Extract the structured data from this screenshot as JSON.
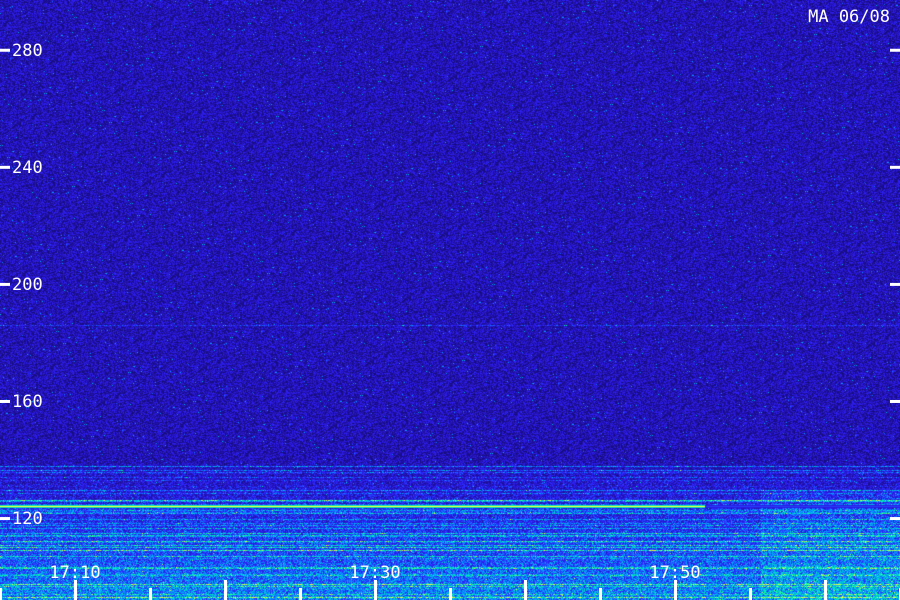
{
  "chart_data": {
    "type": "heatmap",
    "title": "MA 06/08",
    "xlabel": "",
    "ylabel": "",
    "x_ticks": [
      "17:10",
      "17:30",
      "17:50"
    ],
    "y_ticks": [
      120,
      160,
      200,
      240,
      280
    ],
    "ylim": [
      92,
      297
    ],
    "x_range_minutes": [
      1025,
      1085
    ],
    "minor_tick_interval_minutes": 5,
    "colormap": [
      "#0a0a50",
      "#2010a0",
      "#3020ff",
      "#00a0ff",
      "#00ffa0",
      "#ffff40"
    ],
    "features": [
      {
        "name": "carrier",
        "freq": 124,
        "end_time": "17:52",
        "intensity": 1.0
      },
      {
        "name": "band",
        "freq_range": [
          110,
          140
        ],
        "intensity": 0.6
      },
      {
        "name": "faint",
        "freq": 186,
        "intensity": 0.25
      }
    ]
  }
}
